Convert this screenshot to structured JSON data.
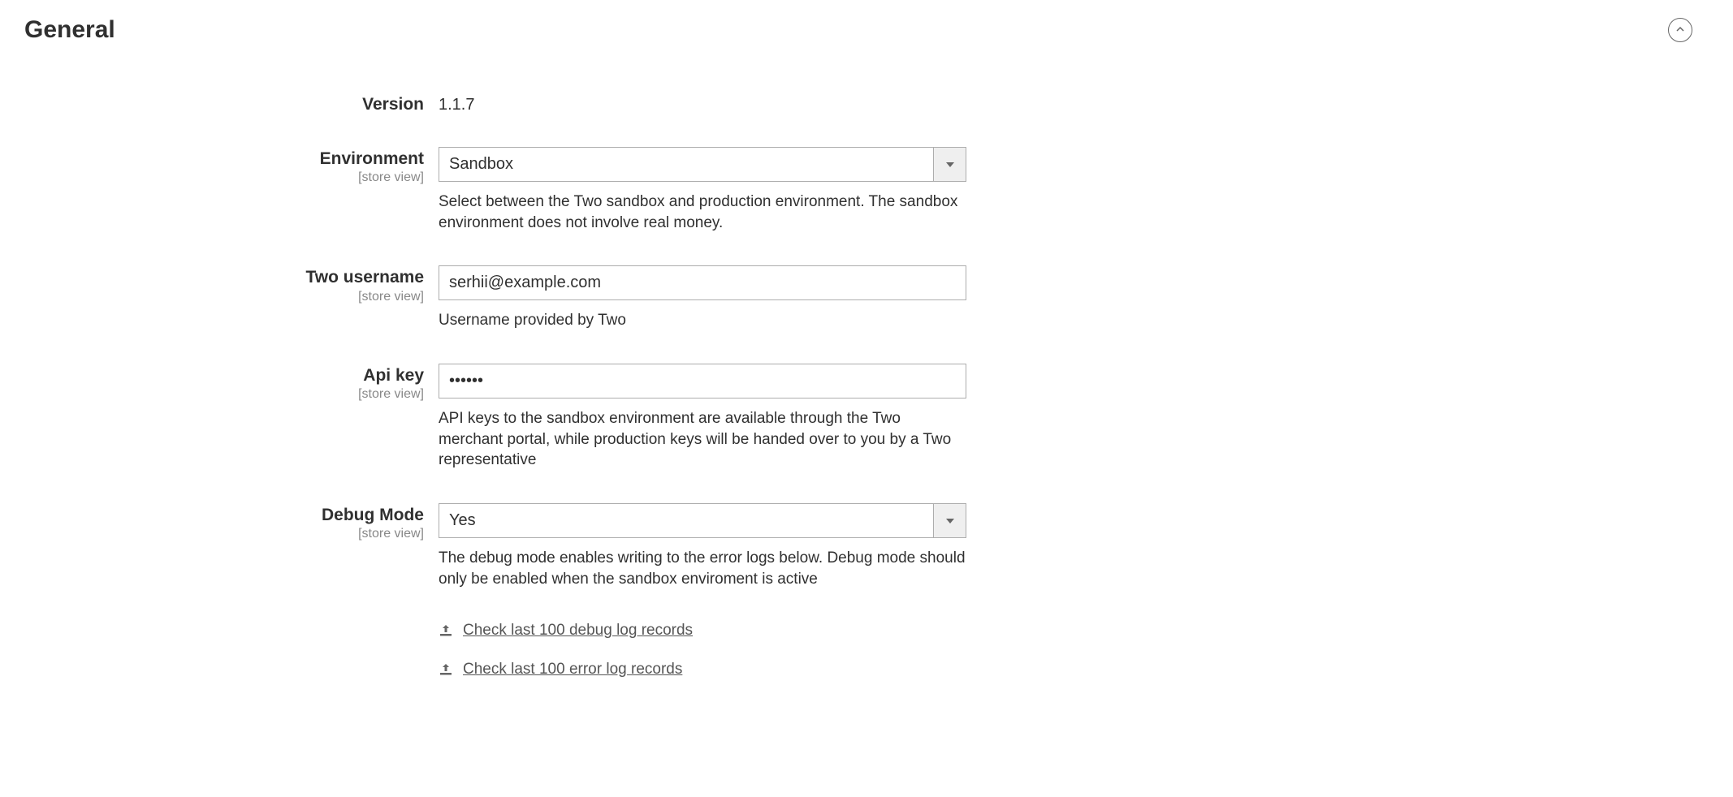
{
  "section": {
    "title": "General"
  },
  "fields": {
    "version": {
      "label": "Version",
      "value": "1.1.7"
    },
    "environment": {
      "label": "Environment",
      "scope": "[store view]",
      "value": "Sandbox",
      "help": "Select between the Two sandbox and production environment. The sandbox environment does not involve real money."
    },
    "username": {
      "label": "Two username",
      "scope": "[store view]",
      "value": "serhii@example.com",
      "help": "Username provided by Two"
    },
    "apikey": {
      "label": "Api key",
      "scope": "[store view]",
      "value": "••••••",
      "help": "API keys to the sandbox environment are available through the Two merchant portal, while production keys will be handed over to you by a Two representative"
    },
    "debug": {
      "label": "Debug Mode",
      "scope": "[store view]",
      "value": "Yes",
      "help": "The debug mode enables writing to the error logs below. Debug mode should only be enabled when the sandbox enviroment is active"
    }
  },
  "logLinks": {
    "debug": "Check last 100 debug log records",
    "error": "Check last 100 error log records"
  }
}
